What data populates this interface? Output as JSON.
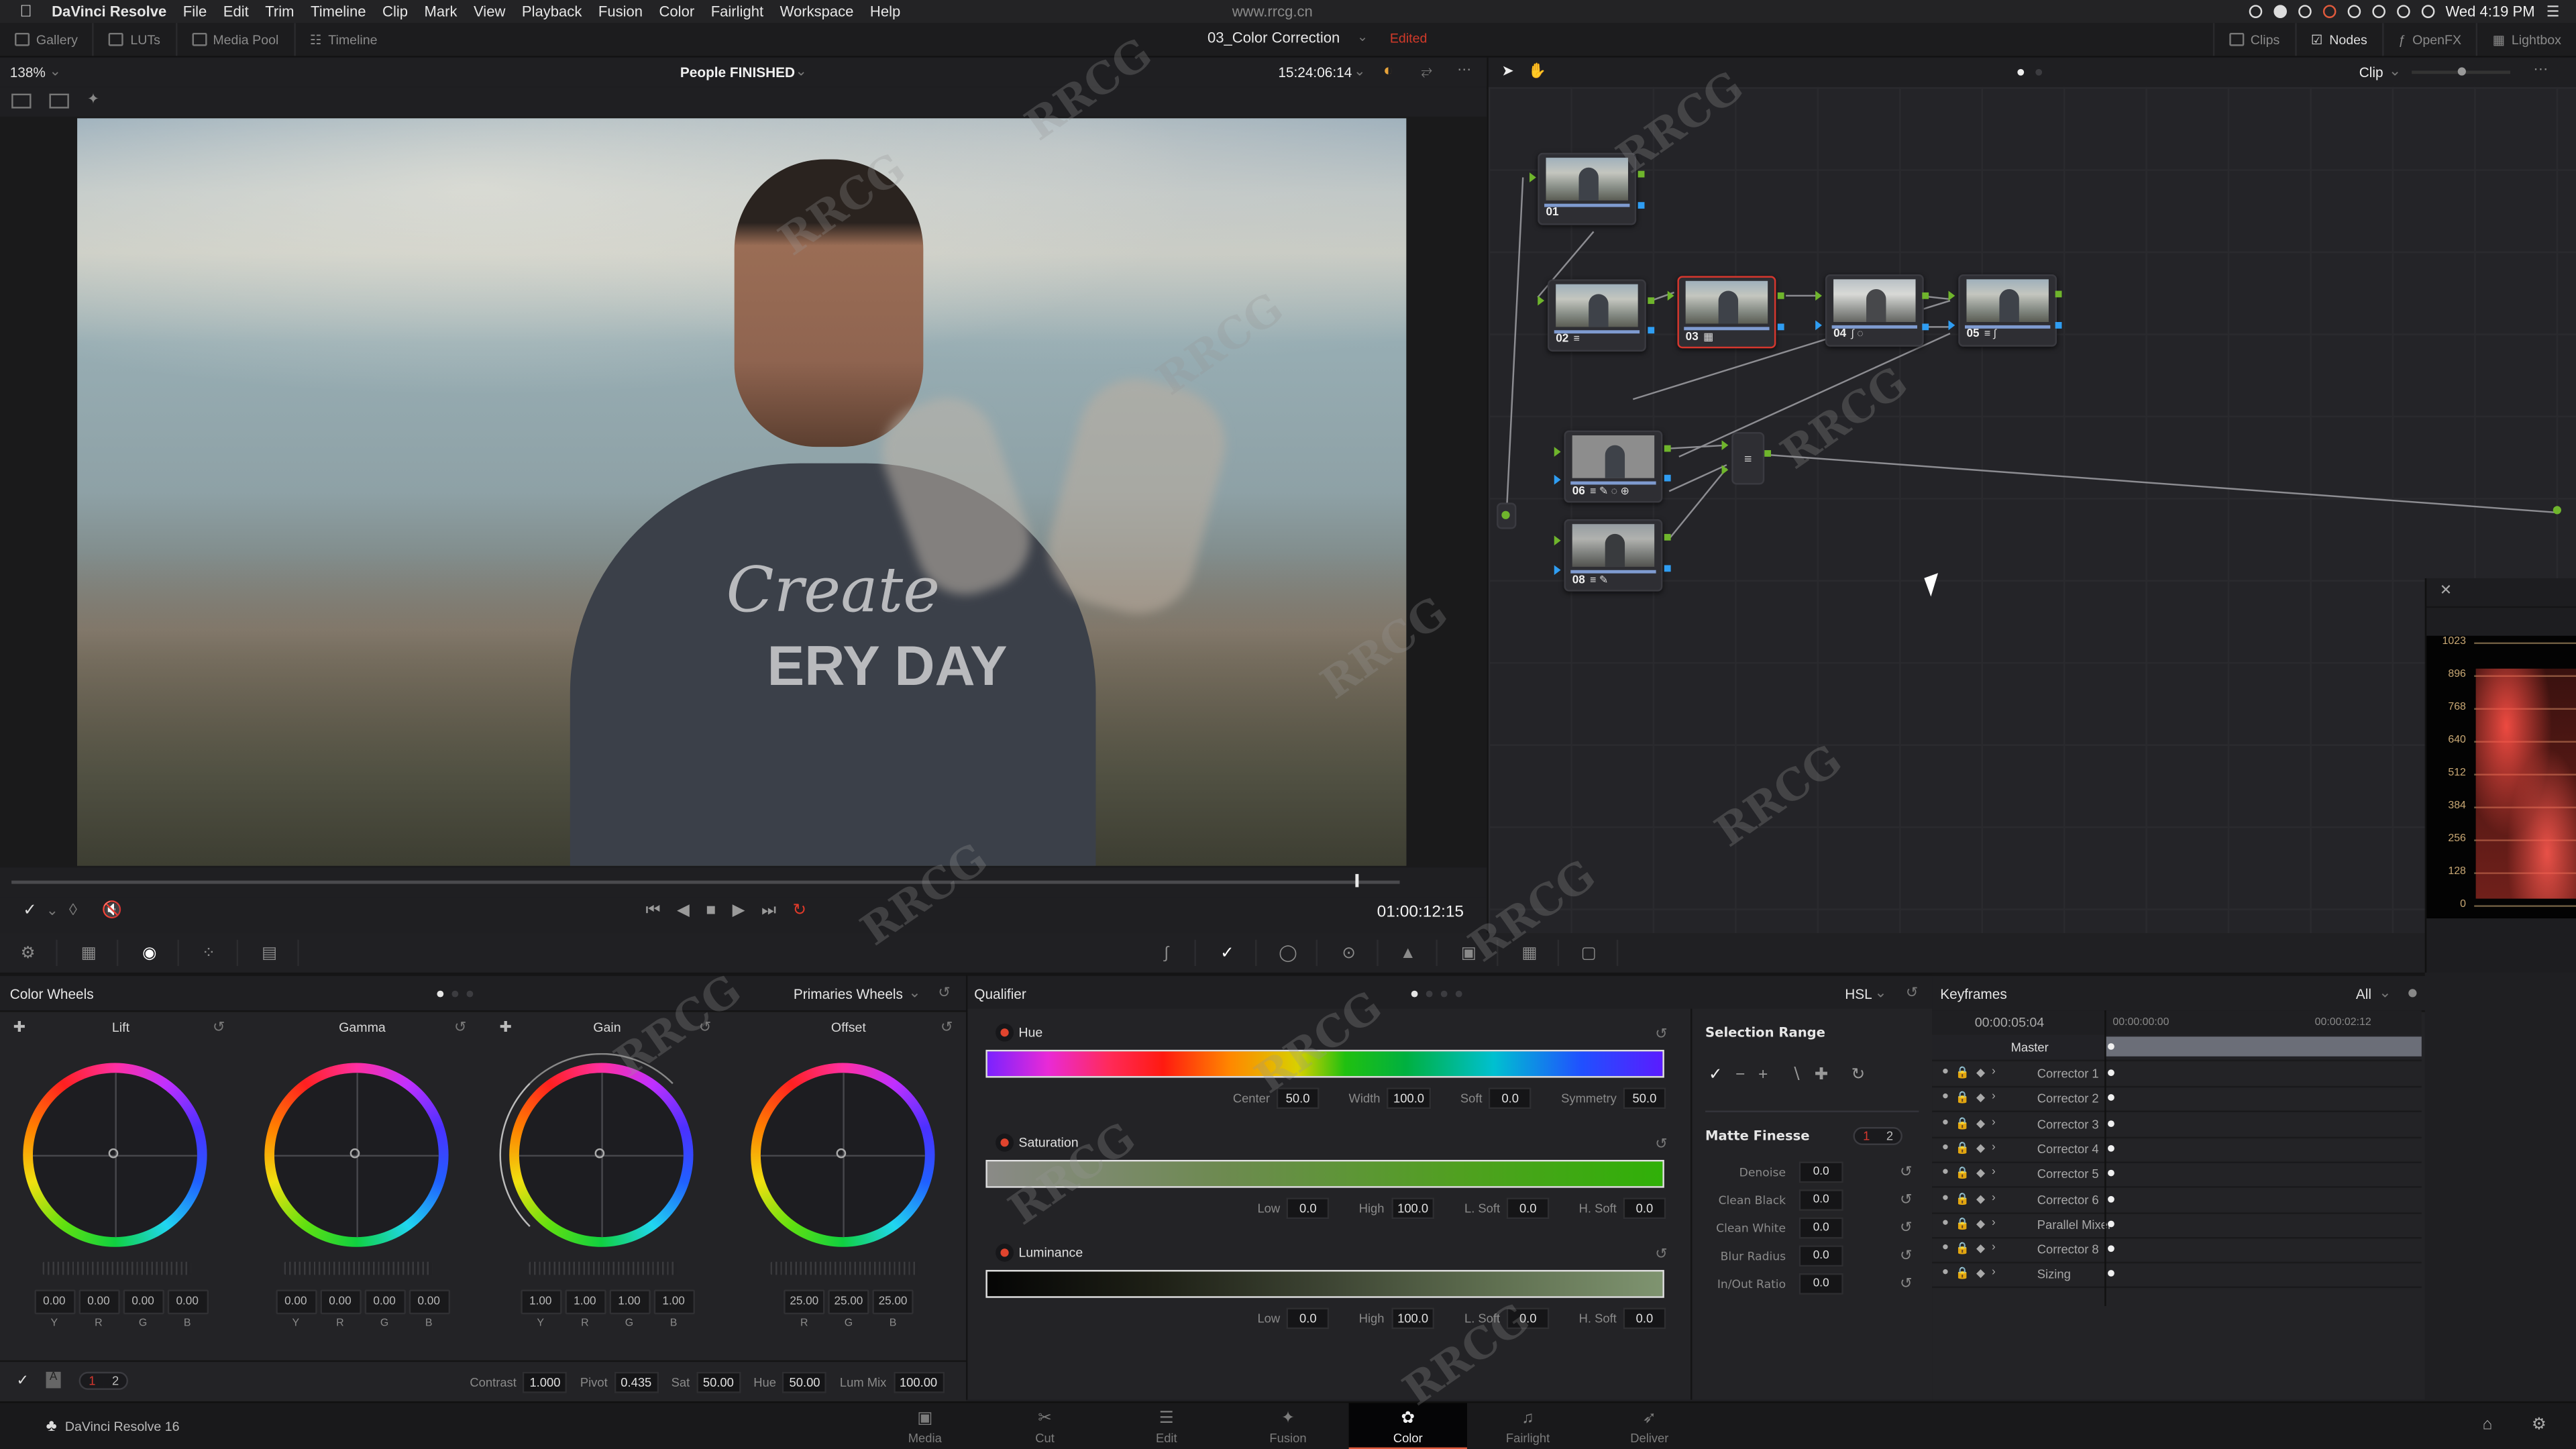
{
  "menubar": {
    "app_name": "DaVinci Resolve",
    "items": [
      "File",
      "Edit",
      "Trim",
      "Timeline",
      "Clip",
      "Mark",
      "View",
      "Playback",
      "Fusion",
      "Color",
      "Fairlight",
      "Workspace",
      "Help"
    ],
    "clock": "Wed 4:19 PM"
  },
  "toolbar": {
    "left": [
      {
        "label": "Gallery",
        "icon": "gallery-icon"
      },
      {
        "label": "LUTs",
        "icon": "luts-icon"
      },
      {
        "label": "Media Pool",
        "icon": "media-pool-icon"
      },
      {
        "label": "Timeline",
        "icon": "timeline-icon"
      }
    ],
    "project_title": "03_Color Correction",
    "project_status": "Edited",
    "right": [
      {
        "label": "Clips",
        "icon": "clips-icon"
      },
      {
        "label": "Nodes",
        "icon": "nodes-icon"
      },
      {
        "label": "OpenFX",
        "icon": "openfx-icon"
      },
      {
        "label": "Lightbox",
        "icon": "lightbox-icon"
      }
    ]
  },
  "viewer": {
    "zoom": "138%",
    "clip_name": "People FINISHED",
    "source_timecode": "15:24:06:14",
    "timecode": "01:00:12:15",
    "playhead_fraction": 0.97
  },
  "node_editor": {
    "mode": "Clip",
    "nodes": [
      {
        "id": "01",
        "icons": ""
      },
      {
        "id": "02",
        "icons": "≡"
      },
      {
        "id": "03",
        "icons": "▦",
        "selected": true
      },
      {
        "id": "04",
        "icons": "∫ ◌"
      },
      {
        "id": "05",
        "icons": "≡ ∫"
      },
      {
        "id": "06",
        "icons": "≡ ✎ ◌ ⊕"
      },
      {
        "id": "08",
        "icons": "≡ ✎"
      }
    ]
  },
  "scope": {
    "ticks": [
      "1023",
      "896",
      "768",
      "640",
      "512",
      "384",
      "256",
      "128",
      "0"
    ]
  },
  "color_wheels": {
    "title": "Color Wheels",
    "mode": "Primaries Wheels",
    "wheels": [
      {
        "name": "Lift",
        "values": [
          {
            "l": "Y",
            "v": "0.00"
          },
          {
            "l": "R",
            "v": "0.00"
          },
          {
            "l": "G",
            "v": "0.00"
          },
          {
            "l": "B",
            "v": "0.00"
          }
        ]
      },
      {
        "name": "Gamma",
        "values": [
          {
            "l": "Y",
            "v": "0.00"
          },
          {
            "l": "R",
            "v": "0.00"
          },
          {
            "l": "G",
            "v": "0.00"
          },
          {
            "l": "B",
            "v": "0.00"
          }
        ]
      },
      {
        "name": "Gain",
        "values": [
          {
            "l": "Y",
            "v": "1.00"
          },
          {
            "l": "R",
            "v": "1.00"
          },
          {
            "l": "G",
            "v": "1.00"
          },
          {
            "l": "B",
            "v": "1.00"
          }
        ]
      },
      {
        "name": "Offset",
        "values": [
          {
            "l": "R",
            "v": "25.00"
          },
          {
            "l": "G",
            "v": "25.00"
          },
          {
            "l": "B",
            "v": "25.00"
          }
        ]
      }
    ],
    "footer": {
      "page1": "1",
      "page2": "2",
      "contrast_label": "Contrast",
      "contrast": "1.000",
      "pivot_label": "Pivot",
      "pivot": "0.435",
      "sat_label": "Sat",
      "sat": "50.00",
      "hue_label": "Hue",
      "hue": "50.00",
      "lummix_label": "Lum Mix",
      "lummix": "100.00"
    }
  },
  "qualifier": {
    "title": "Qualifier",
    "mode": "HSL",
    "hue": {
      "label": "Hue",
      "center_label": "Center",
      "center": "50.0",
      "width_label": "Width",
      "width": "100.0",
      "soft_label": "Soft",
      "soft": "0.0",
      "sym_label": "Symmetry",
      "sym": "50.0"
    },
    "saturation": {
      "label": "Saturation",
      "low_label": "Low",
      "low": "0.0",
      "high_label": "High",
      "high": "100.0",
      "lsoft_label": "L. Soft",
      "lsoft": "0.0",
      "hsoft_label": "H. Soft",
      "hsoft": "0.0"
    },
    "luminance": {
      "label": "Luminance",
      "low_label": "Low",
      "low": "0.0",
      "high_label": "High",
      "high": "100.0",
      "lsoft_label": "L. Soft",
      "lsoft": "0.0",
      "hsoft_label": "H. Soft",
      "hsoft": "0.0"
    },
    "selection_range": "Selection Range",
    "matte_finesse": "Matte Finesse",
    "mf_page1": "1",
    "mf_page2": "2",
    "matte": [
      {
        "label": "Denoise",
        "value": "0.0"
      },
      {
        "label": "Clean Black",
        "value": "0.0"
      },
      {
        "label": "Clean White",
        "value": "0.0"
      },
      {
        "label": "Blur Radius",
        "value": "0.0"
      },
      {
        "label": "In/Out Ratio",
        "value": "0.0"
      }
    ]
  },
  "keyframes": {
    "title": "Keyframes",
    "filter": "All",
    "current_tc": "00:00:05:04",
    "ruler": [
      "00:00:00:00",
      "00:00:02:12"
    ],
    "master": "Master",
    "tracks": [
      "Corrector 1",
      "Corrector 2",
      "Corrector 3",
      "Corrector 4",
      "Corrector 5",
      "Corrector 6",
      "Parallel Mixer",
      "Corrector 8",
      "Sizing"
    ]
  },
  "pages": {
    "brand": "DaVinci Resolve 16",
    "tabs": [
      {
        "label": "Media",
        "icon": "▣"
      },
      {
        "label": "Cut",
        "icon": "✂"
      },
      {
        "label": "Edit",
        "icon": "☰"
      },
      {
        "label": "Fusion",
        "icon": "✦"
      },
      {
        "label": "Color",
        "icon": "✿",
        "active": true
      },
      {
        "label": "Fairlight",
        "icon": "♫"
      },
      {
        "label": "Deliver",
        "icon": "➶"
      }
    ]
  },
  "watermark": "www.rrcg.cn"
}
